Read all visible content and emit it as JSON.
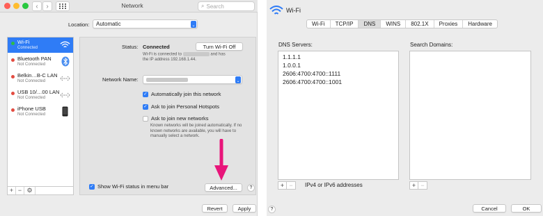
{
  "left": {
    "title": "Network",
    "search_placeholder": "Search",
    "location_label": "Location:",
    "location_value": "Automatic",
    "services": [
      {
        "name": "Wi-Fi",
        "status": "Connected",
        "dot": "#2ebd45",
        "icon": "wifi-icon",
        "selected": true
      },
      {
        "name": "Bluetooth PAN",
        "status": "Not Connected",
        "dot": "#e34c41",
        "icon": "bluetooth-icon"
      },
      {
        "name": "Belkin…B-C LAN",
        "status": "Not Connected",
        "dot": "#e34c41",
        "icon": "ethernet-arrows-icon"
      },
      {
        "name": "USB 10/…00 LAN",
        "status": "Not Connected",
        "dot": "#e34c41",
        "icon": "ethernet-arrows-icon"
      },
      {
        "name": "iPhone USB",
        "status": "Not Connected",
        "dot": "#e34c41",
        "icon": "iphone-icon"
      }
    ],
    "status_label": "Status:",
    "status_value": "Connected",
    "turn_off_button": "Turn Wi-Fi Off",
    "status_desc_1": "Wi-Fi is connected to",
    "status_desc_2": "and has",
    "status_desc_3": "the IP address 192.168.1.44.",
    "network_name_label": "Network Name:",
    "check_auto_join": "Automatically join this network",
    "check_hotspots": "Ask to join Personal Hotspots",
    "check_new_networks": "Ask to join new networks",
    "new_networks_note": "Known networks will be joined automatically. If no known networks are available, you will have to manually select a network.",
    "show_status_menu": "Show Wi-Fi status in menu bar",
    "advanced_button": "Advanced...",
    "revert_button": "Revert",
    "apply_button": "Apply",
    "help": "?",
    "accent": "#2f7cf6",
    "arrow_color": "#e8157a"
  },
  "right": {
    "title": "Wi-Fi",
    "tabs": [
      "Wi-Fi",
      "TCP/IP",
      "DNS",
      "WINS",
      "802.1X",
      "Proxies",
      "Hardware"
    ],
    "selected_tab": "DNS",
    "dns_servers_label": "DNS Servers:",
    "dns_servers": [
      "1.1.1.1",
      "1.0.0.1",
      "2606:4700:4700::1111",
      "2606:4700:4700::1001"
    ],
    "search_domains_label": "Search Domains:",
    "ipv_hint": "IPv4 or IPv6 addresses",
    "cancel_button": "Cancel",
    "ok_button": "OK",
    "help": "?"
  }
}
